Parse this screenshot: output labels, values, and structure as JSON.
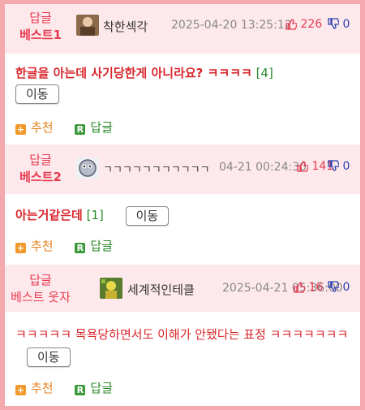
{
  "comments": [
    {
      "rank_line1": "답글",
      "rank_line2": "베스트1",
      "nickname": "착한섹각",
      "date": "2025-04-20 13:25:12",
      "up": "226",
      "down": "0",
      "text": "한글을 아는데 사기당한게 아니라요? ㅋㅋㅋㅋ",
      "reply_count": "[4]",
      "move_label": "이동",
      "recommend_label": "추천",
      "reply_label": "답글",
      "avatar_icon": "avatar-photo-icon"
    },
    {
      "rank_line1": "답글",
      "rank_line2": "베스트2",
      "nickname": "ㄱㄱㄱㄱㄱㄱㄱㄱㄱㄱㄱ",
      "date": "04-21 00:24:30",
      "up": "141",
      "down": "0",
      "text": "아는거같은데",
      "reply_count": "[1]",
      "move_label": "이동",
      "recommend_label": "추천",
      "reply_label": "답글",
      "avatar_icon": "avatar-ghost-icon"
    },
    {
      "rank_line1": "답글",
      "rank_line2": "베스트 웃자",
      "nickname": "세계적인테클",
      "date": "2025-04-21 05:36:00",
      "up": "16",
      "down": "0",
      "text": "ㅋㅋㅋㅋㅋ 목욕당하면서도 이해가 안됐다는 표정 ㅋㅋㅋㅋㅋㅋㅋ",
      "move_label": "이동",
      "recommend_label": "추천",
      "reply_label": "답글",
      "avatar_icon": "avatar-character-icon"
    }
  ],
  "colors": {
    "accent_red": "#e8384f",
    "header_bg": "#fde9eb",
    "border_pink": "#f4a9ae",
    "recommend_orange": "#e2811b",
    "reply_green": "#2a8a2a",
    "dislike_blue": "#2a3fb3"
  }
}
